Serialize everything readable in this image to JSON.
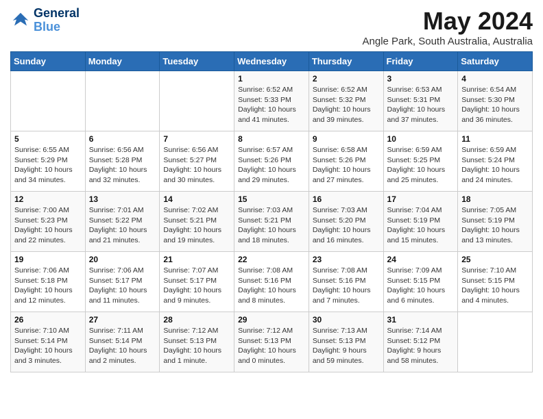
{
  "logo": {
    "line1": "General",
    "line2": "Blue"
  },
  "title": "May 2024",
  "location": "Angle Park, South Australia, Australia",
  "days_header": [
    "Sunday",
    "Monday",
    "Tuesday",
    "Wednesday",
    "Thursday",
    "Friday",
    "Saturday"
  ],
  "weeks": [
    [
      {
        "day": "",
        "info": ""
      },
      {
        "day": "",
        "info": ""
      },
      {
        "day": "",
        "info": ""
      },
      {
        "day": "1",
        "info": "Sunrise: 6:52 AM\nSunset: 5:33 PM\nDaylight: 10 hours\nand 41 minutes."
      },
      {
        "day": "2",
        "info": "Sunrise: 6:52 AM\nSunset: 5:32 PM\nDaylight: 10 hours\nand 39 minutes."
      },
      {
        "day": "3",
        "info": "Sunrise: 6:53 AM\nSunset: 5:31 PM\nDaylight: 10 hours\nand 37 minutes."
      },
      {
        "day": "4",
        "info": "Sunrise: 6:54 AM\nSunset: 5:30 PM\nDaylight: 10 hours\nand 36 minutes."
      }
    ],
    [
      {
        "day": "5",
        "info": "Sunrise: 6:55 AM\nSunset: 5:29 PM\nDaylight: 10 hours\nand 34 minutes."
      },
      {
        "day": "6",
        "info": "Sunrise: 6:56 AM\nSunset: 5:28 PM\nDaylight: 10 hours\nand 32 minutes."
      },
      {
        "day": "7",
        "info": "Sunrise: 6:56 AM\nSunset: 5:27 PM\nDaylight: 10 hours\nand 30 minutes."
      },
      {
        "day": "8",
        "info": "Sunrise: 6:57 AM\nSunset: 5:26 PM\nDaylight: 10 hours\nand 29 minutes."
      },
      {
        "day": "9",
        "info": "Sunrise: 6:58 AM\nSunset: 5:26 PM\nDaylight: 10 hours\nand 27 minutes."
      },
      {
        "day": "10",
        "info": "Sunrise: 6:59 AM\nSunset: 5:25 PM\nDaylight: 10 hours\nand 25 minutes."
      },
      {
        "day": "11",
        "info": "Sunrise: 6:59 AM\nSunset: 5:24 PM\nDaylight: 10 hours\nand 24 minutes."
      }
    ],
    [
      {
        "day": "12",
        "info": "Sunrise: 7:00 AM\nSunset: 5:23 PM\nDaylight: 10 hours\nand 22 minutes."
      },
      {
        "day": "13",
        "info": "Sunrise: 7:01 AM\nSunset: 5:22 PM\nDaylight: 10 hours\nand 21 minutes."
      },
      {
        "day": "14",
        "info": "Sunrise: 7:02 AM\nSunset: 5:21 PM\nDaylight: 10 hours\nand 19 minutes."
      },
      {
        "day": "15",
        "info": "Sunrise: 7:03 AM\nSunset: 5:21 PM\nDaylight: 10 hours\nand 18 minutes."
      },
      {
        "day": "16",
        "info": "Sunrise: 7:03 AM\nSunset: 5:20 PM\nDaylight: 10 hours\nand 16 minutes."
      },
      {
        "day": "17",
        "info": "Sunrise: 7:04 AM\nSunset: 5:19 PM\nDaylight: 10 hours\nand 15 minutes."
      },
      {
        "day": "18",
        "info": "Sunrise: 7:05 AM\nSunset: 5:19 PM\nDaylight: 10 hours\nand 13 minutes."
      }
    ],
    [
      {
        "day": "19",
        "info": "Sunrise: 7:06 AM\nSunset: 5:18 PM\nDaylight: 10 hours\nand 12 minutes."
      },
      {
        "day": "20",
        "info": "Sunrise: 7:06 AM\nSunset: 5:17 PM\nDaylight: 10 hours\nand 11 minutes."
      },
      {
        "day": "21",
        "info": "Sunrise: 7:07 AM\nSunset: 5:17 PM\nDaylight: 10 hours\nand 9 minutes."
      },
      {
        "day": "22",
        "info": "Sunrise: 7:08 AM\nSunset: 5:16 PM\nDaylight: 10 hours\nand 8 minutes."
      },
      {
        "day": "23",
        "info": "Sunrise: 7:08 AM\nSunset: 5:16 PM\nDaylight: 10 hours\nand 7 minutes."
      },
      {
        "day": "24",
        "info": "Sunrise: 7:09 AM\nSunset: 5:15 PM\nDaylight: 10 hours\nand 6 minutes."
      },
      {
        "day": "25",
        "info": "Sunrise: 7:10 AM\nSunset: 5:15 PM\nDaylight: 10 hours\nand 4 minutes."
      }
    ],
    [
      {
        "day": "26",
        "info": "Sunrise: 7:10 AM\nSunset: 5:14 PM\nDaylight: 10 hours\nand 3 minutes."
      },
      {
        "day": "27",
        "info": "Sunrise: 7:11 AM\nSunset: 5:14 PM\nDaylight: 10 hours\nand 2 minutes."
      },
      {
        "day": "28",
        "info": "Sunrise: 7:12 AM\nSunset: 5:13 PM\nDaylight: 10 hours\nand 1 minute."
      },
      {
        "day": "29",
        "info": "Sunrise: 7:12 AM\nSunset: 5:13 PM\nDaylight: 10 hours\nand 0 minutes."
      },
      {
        "day": "30",
        "info": "Sunrise: 7:13 AM\nSunset: 5:13 PM\nDaylight: 9 hours\nand 59 minutes."
      },
      {
        "day": "31",
        "info": "Sunrise: 7:14 AM\nSunset: 5:12 PM\nDaylight: 9 hours\nand 58 minutes."
      },
      {
        "day": "",
        "info": ""
      }
    ]
  ]
}
